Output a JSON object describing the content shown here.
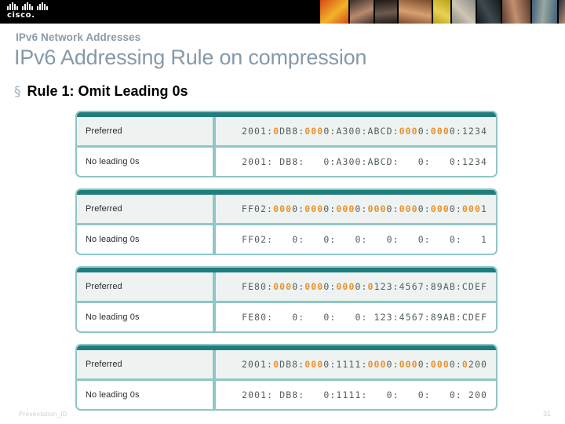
{
  "brand": {
    "logo_wordmark": "cisco.",
    "logo_icon": "cisco-bridge-icon"
  },
  "slide": {
    "eyebrow": "IPv6 Network Addresses",
    "title": "IPv6 Addressing Rule on compression",
    "bullet_mark": "§",
    "bullet_text": "Rule 1: Omit Leading 0s"
  },
  "colors": {
    "table_border": "#8fc6c6",
    "table_cap": "#1f7d7d",
    "highlight": "#e8922e",
    "title_text": "#8599a8",
    "topbar": "#000000"
  },
  "labels": {
    "preferred": "Preferred",
    "compressed": "No leading 0s"
  },
  "tables": [
    {
      "preferred_parts": [
        {
          "t": "2001:",
          "hl": false
        },
        {
          "t": "0",
          "hl": true
        },
        {
          "t": "DB8:",
          "hl": false
        },
        {
          "t": "000",
          "hl": true
        },
        {
          "t": "0:A300:ABCD:",
          "hl": false
        },
        {
          "t": "000",
          "hl": true
        },
        {
          "t": "0:",
          "hl": false
        },
        {
          "t": "000",
          "hl": true
        },
        {
          "t": "0:1234",
          "hl": false
        }
      ],
      "preferred_text": "2001:0DB8:0000:A300:ABCD:0000:0000:1234",
      "compressed_text": "2001: DB8:   0:A300:ABCD:   0:   0:1234"
    },
    {
      "preferred_parts": [
        {
          "t": "FF02:",
          "hl": false
        },
        {
          "t": "000",
          "hl": true
        },
        {
          "t": "0:",
          "hl": false
        },
        {
          "t": "000",
          "hl": true
        },
        {
          "t": "0:",
          "hl": false
        },
        {
          "t": "000",
          "hl": true
        },
        {
          "t": "0:",
          "hl": false
        },
        {
          "t": "000",
          "hl": true
        },
        {
          "t": "0:",
          "hl": false
        },
        {
          "t": "000",
          "hl": true
        },
        {
          "t": "0:",
          "hl": false
        },
        {
          "t": "000",
          "hl": true
        },
        {
          "t": "0:",
          "hl": false
        },
        {
          "t": "000",
          "hl": true
        },
        {
          "t": "1",
          "hl": false
        }
      ],
      "preferred_text": "FF02:0000:0000:0000:0000:0000:0000:0001",
      "compressed_text": "FF02:   0:   0:   0:   0:   0:   0:   1"
    },
    {
      "preferred_parts": [
        {
          "t": "FE80:",
          "hl": false
        },
        {
          "t": "000",
          "hl": true
        },
        {
          "t": "0:",
          "hl": false
        },
        {
          "t": "000",
          "hl": true
        },
        {
          "t": "0:",
          "hl": false
        },
        {
          "t": "000",
          "hl": true
        },
        {
          "t": "0:",
          "hl": false
        },
        {
          "t": "0",
          "hl": true
        },
        {
          "t": "123:4567:89AB:CDEF",
          "hl": false
        }
      ],
      "preferred_text": "FE80:0000:0000:0000:0123:4567:89AB:CDEF",
      "compressed_text": "FE80:   0:   0:   0: 123:4567:89AB:CDEF"
    },
    {
      "preferred_parts": [
        {
          "t": "2001:",
          "hl": false
        },
        {
          "t": "0",
          "hl": true
        },
        {
          "t": "DB8:",
          "hl": false
        },
        {
          "t": "000",
          "hl": true
        },
        {
          "t": "0:1111:",
          "hl": false
        },
        {
          "t": "000",
          "hl": true
        },
        {
          "t": "0:",
          "hl": false
        },
        {
          "t": "000",
          "hl": true
        },
        {
          "t": "0:",
          "hl": false
        },
        {
          "t": "000",
          "hl": true
        },
        {
          "t": "0:",
          "hl": false
        },
        {
          "t": "0",
          "hl": true
        },
        {
          "t": "200",
          "hl": false
        }
      ],
      "preferred_text": "2001:0DB8:0000:1111:0000:0000:0000:0200",
      "compressed_text": "2001: DB8:   0:1111:   0:   0:   0: 200"
    }
  ],
  "footer": {
    "left": "Presentation_ID",
    "page": "31"
  },
  "photostrip": {
    "tiles": [
      {
        "name": "photo-abstract-orange",
        "width": 36,
        "color_a": "#d84a16",
        "color_b": "#f0b428"
      },
      {
        "name": "photo-woman-dark-hair",
        "width": 30,
        "color_a": "#3b2f2a",
        "color_b": "#b98a6e"
      },
      {
        "name": "photo-man-thinking",
        "width": 28,
        "color_a": "#1e1a18",
        "color_b": "#6e5a4c"
      },
      {
        "name": "photo-woman-closeup",
        "width": 42,
        "color_a": "#7a4a2c",
        "color_b": "#d8a070"
      },
      {
        "name": "photo-yellow-fabric",
        "width": 22,
        "color_a": "#b9a218",
        "color_b": "#e8d254"
      },
      {
        "name": "photo-woman-headscarf",
        "width": 30,
        "color_a": "#8a8a86",
        "color_b": "#cfc6b4"
      },
      {
        "name": "photo-dark-scene",
        "width": 30,
        "color_a": "#16181a",
        "color_b": "#3c4a50"
      },
      {
        "name": "photo-woman-profile",
        "width": 36,
        "color_a": "#5a3a2c",
        "color_b": "#c29070"
      },
      {
        "name": "photo-man-blue-bg",
        "width": 32,
        "color_a": "#3e5f79",
        "color_b": "#9aa8a0"
      },
      {
        "name": "photo-man-cap",
        "width": 32,
        "color_a": "#2a2f3a",
        "color_b": "#b08a70"
      }
    ]
  }
}
